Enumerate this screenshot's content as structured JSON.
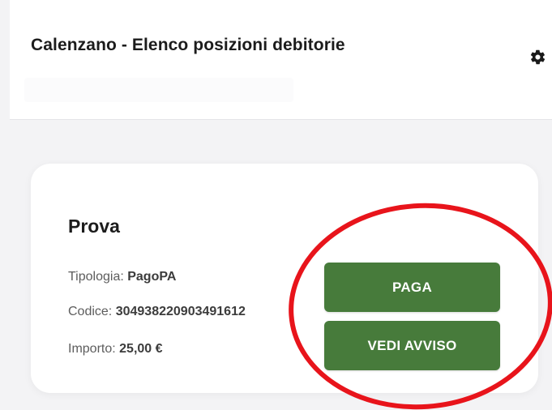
{
  "header": {
    "title": "Calenzano - Elenco posizioni debitorie",
    "settings_icon": "gear-icon"
  },
  "card": {
    "title": "Prova",
    "tipologia_label": "Tipologia: ",
    "tipologia_value": "PagoPA",
    "codice_label": "Codice: ",
    "codice_value": "304938220903491612",
    "importo_label": "Importo: ",
    "importo_value": "25,00 €",
    "pay_label": "PAGA",
    "notice_label": "VEDI AVVISO"
  },
  "colors": {
    "button_green": "#477b3b",
    "annotation_red": "#e8141b",
    "background": "#f3f3f5"
  }
}
